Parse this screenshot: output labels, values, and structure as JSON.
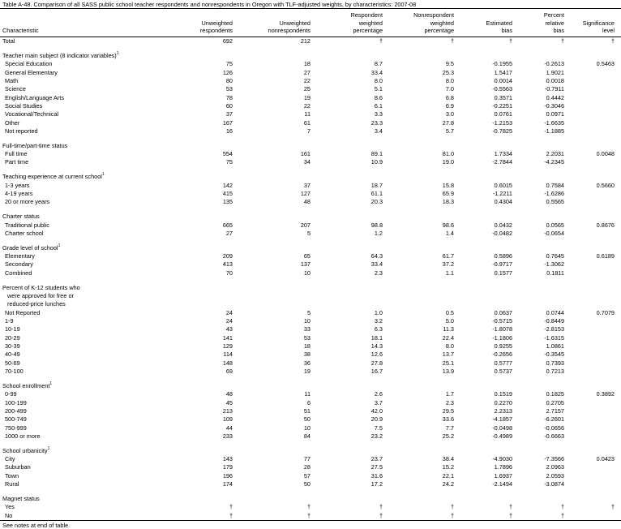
{
  "title": "Table A-48. Comparison of all SASS public school teacher respondents and nonrespondents in Oregon with TLF-adjusted weights, by characteristics: 2007-08",
  "headers": [
    "Characteristic",
    "Unweighted\nrespondents",
    "Unweighted\nnonrespondents",
    "Respondent\nweighted\npercentage",
    "Nonrespondent\nweighted\npercentage",
    "Estimated\nbias",
    "Percent\nrelative\nbias",
    "Significance\nlevel"
  ],
  "rows": [
    {
      "t": "data",
      "ind": 0,
      "cells": [
        "Total",
        "692",
        "212",
        "†",
        "†",
        "†",
        "†",
        "†"
      ]
    },
    {
      "t": "sp"
    },
    {
      "t": "head",
      "label": "Teacher main subject (8 indicator variables)",
      "sup": "1"
    },
    {
      "t": "data",
      "ind": 1,
      "cells": [
        "Special Education",
        "75",
        "18",
        "8.7",
        "9.5",
        "-0.1955",
        "-0.2613",
        "0.5463"
      ]
    },
    {
      "t": "data",
      "ind": 1,
      "cells": [
        "General Elementary",
        "126",
        "27",
        "33.4",
        "25.3",
        "1.5417",
        "1.9021",
        ""
      ]
    },
    {
      "t": "data",
      "ind": 1,
      "cells": [
        "Math",
        "80",
        "22",
        "8.0",
        "8.0",
        "0.0014",
        "0.0018",
        ""
      ]
    },
    {
      "t": "data",
      "ind": 1,
      "cells": [
        "Science",
        "53",
        "25",
        "5.1",
        "7.0",
        "-0.5563",
        "-0.7911",
        ""
      ]
    },
    {
      "t": "data",
      "ind": 1,
      "cells": [
        "English/Language Arts",
        "78",
        "19",
        "8.6",
        "6.8",
        "0.3571",
        "0.4442",
        ""
      ]
    },
    {
      "t": "data",
      "ind": 1,
      "cells": [
        "Social Studies",
        "60",
        "22",
        "6.1",
        "6.9",
        "-0.2251",
        "-0.3046",
        ""
      ]
    },
    {
      "t": "data",
      "ind": 1,
      "cells": [
        "Vocational/Technical",
        "37",
        "11",
        "3.3",
        "3.0",
        "0.0761",
        "0.0971",
        ""
      ]
    },
    {
      "t": "data",
      "ind": 1,
      "cells": [
        "Other",
        "167",
        "61",
        "23.3",
        "27.8",
        "-1.2153",
        "-1.6635",
        ""
      ]
    },
    {
      "t": "data",
      "ind": 1,
      "cells": [
        "Not reported",
        "16",
        "7",
        "3.4",
        "5.7",
        "-0.7825",
        "-1.1885",
        ""
      ]
    },
    {
      "t": "sp"
    },
    {
      "t": "head",
      "label": "Full-time/part-time status",
      "sup": ""
    },
    {
      "t": "data",
      "ind": 1,
      "cells": [
        "Full time",
        "554",
        "161",
        "89.1",
        "81.0",
        "1.7334",
        "2.2031",
        "0.0048"
      ]
    },
    {
      "t": "data",
      "ind": 1,
      "cells": [
        "Part time",
        "75",
        "34",
        "10.9",
        "19.0",
        "-2.7844",
        "-4.2345",
        ""
      ]
    },
    {
      "t": "sp"
    },
    {
      "t": "head",
      "label": "Teaching experience at current school",
      "sup": "1"
    },
    {
      "t": "data",
      "ind": 1,
      "cells": [
        "1-3 years",
        "142",
        "37",
        "18.7",
        "15.8",
        "0.6015",
        "0.7584",
        "0.5660"
      ]
    },
    {
      "t": "data",
      "ind": 1,
      "cells": [
        "4-19 years",
        "415",
        "127",
        "61.1",
        "65.9",
        "-1.2211",
        "-1.6286",
        ""
      ]
    },
    {
      "t": "data",
      "ind": 1,
      "cells": [
        "20 or more years",
        "135",
        "48",
        "20.3",
        "18.3",
        "0.4304",
        "0.5565",
        ""
      ]
    },
    {
      "t": "sp"
    },
    {
      "t": "head",
      "label": "Charter status",
      "sup": ""
    },
    {
      "t": "data",
      "ind": 1,
      "cells": [
        "Traditional public",
        "665",
        "207",
        "98.8",
        "98.6",
        "0.0432",
        "0.0565",
        "0.8676"
      ]
    },
    {
      "t": "data",
      "ind": 1,
      "cells": [
        "Charter school",
        "27",
        "5",
        "1.2",
        "1.4",
        "-0.0482",
        "-0.0654",
        ""
      ]
    },
    {
      "t": "sp"
    },
    {
      "t": "head",
      "label": "Grade level of school",
      "sup": "1"
    },
    {
      "t": "data",
      "ind": 1,
      "cells": [
        "Elementary",
        "209",
        "65",
        "64.3",
        "61.7",
        "0.5896",
        "0.7645",
        "0.6189"
      ]
    },
    {
      "t": "data",
      "ind": 1,
      "cells": [
        "Secondary",
        "413",
        "137",
        "33.4",
        "37.2",
        "-0.9717",
        "-1.3062",
        ""
      ]
    },
    {
      "t": "data",
      "ind": 1,
      "cells": [
        "Combined",
        "70",
        "10",
        "2.3",
        "1.1",
        "0.1577",
        "0.1811",
        ""
      ]
    },
    {
      "t": "sp"
    },
    {
      "t": "head",
      "label": "Percent of K-12 students who",
      "sup": ""
    },
    {
      "t": "data",
      "ind": 2,
      "cells": [
        "were approved for free or",
        "",
        "",
        "",
        "",
        "",
        "",
        ""
      ]
    },
    {
      "t": "data",
      "ind": 2,
      "cells": [
        "reduced-price lunches",
        "",
        "",
        "",
        "",
        "",
        "",
        ""
      ]
    },
    {
      "t": "data",
      "ind": 1,
      "cells": [
        "Not Reported",
        "24",
        "5",
        "1.0",
        "0.5",
        "0.0637",
        "0.0744",
        "0.7079"
      ]
    },
    {
      "t": "data",
      "ind": 1,
      "cells": [
        "1-9",
        "24",
        "10",
        "3.2",
        "5.0",
        "-0.5715",
        "-0.8449",
        ""
      ]
    },
    {
      "t": "data",
      "ind": 1,
      "cells": [
        "10-19",
        "43",
        "33",
        "6.3",
        "11.3",
        "-1.8078",
        "-2.8153",
        ""
      ]
    },
    {
      "t": "data",
      "ind": 1,
      "cells": [
        "20-29",
        "141",
        "53",
        "18.1",
        "22.4",
        "-1.1806",
        "-1.6315",
        ""
      ]
    },
    {
      "t": "data",
      "ind": 1,
      "cells": [
        "30-39",
        "129",
        "18",
        "14.3",
        "8.0",
        "0.9255",
        "1.0861",
        ""
      ]
    },
    {
      "t": "data",
      "ind": 1,
      "cells": [
        "40-49",
        "114",
        "38",
        "12.6",
        "13.7",
        "-0.2656",
        "-0.3545",
        ""
      ]
    },
    {
      "t": "data",
      "ind": 1,
      "cells": [
        "50-69",
        "148",
        "36",
        "27.8",
        "25.1",
        "0.5777",
        "0.7393",
        ""
      ]
    },
    {
      "t": "data",
      "ind": 1,
      "cells": [
        "70-100",
        "69",
        "19",
        "16.7",
        "13.9",
        "0.5737",
        "0.7213",
        ""
      ]
    },
    {
      "t": "sp"
    },
    {
      "t": "head",
      "label": "School enrollment",
      "sup": "1"
    },
    {
      "t": "data",
      "ind": 1,
      "cells": [
        "0-99",
        "48",
        "11",
        "2.6",
        "1.7",
        "0.1519",
        "0.1825",
        "0.3892"
      ]
    },
    {
      "t": "data",
      "ind": 1,
      "cells": [
        "100-199",
        "45",
        "6",
        "3.7",
        "2.3",
        "0.2270",
        "0.2705",
        ""
      ]
    },
    {
      "t": "data",
      "ind": 1,
      "cells": [
        "200-499",
        "213",
        "51",
        "42.0",
        "29.5",
        "2.2313",
        "2.7157",
        ""
      ]
    },
    {
      "t": "data",
      "ind": 1,
      "cells": [
        "500-749",
        "109",
        "50",
        "20.9",
        "33.6",
        "-4.1857",
        "-6.2601",
        ""
      ]
    },
    {
      "t": "data",
      "ind": 1,
      "cells": [
        "750-999",
        "44",
        "10",
        "7.5",
        "7.7",
        "-0.0498",
        "-0.0656",
        ""
      ]
    },
    {
      "t": "data",
      "ind": 1,
      "cells": [
        "1000 or more",
        "233",
        "84",
        "23.2",
        "25.2",
        "-0.4989",
        "-0.6663",
        ""
      ]
    },
    {
      "t": "sp"
    },
    {
      "t": "head",
      "label": "School urbanicity",
      "sup": "1"
    },
    {
      "t": "data",
      "ind": 1,
      "cells": [
        "City",
        "143",
        "77",
        "23.7",
        "38.4",
        "-4.9030",
        "-7.3566",
        "0.0423"
      ]
    },
    {
      "t": "data",
      "ind": 1,
      "cells": [
        "Suburban",
        "179",
        "28",
        "27.5",
        "15.2",
        "1.7896",
        "2.0963",
        ""
      ]
    },
    {
      "t": "data",
      "ind": 1,
      "cells": [
        "Town",
        "196",
        "57",
        "31.6",
        "22.1",
        "1.6937",
        "2.0593",
        ""
      ]
    },
    {
      "t": "data",
      "ind": 1,
      "cells": [
        "Rural",
        "174",
        "50",
        "17.2",
        "24.2",
        "-2.1494",
        "-3.0874",
        ""
      ]
    },
    {
      "t": "sp"
    },
    {
      "t": "head",
      "label": "Magnet status",
      "sup": ""
    },
    {
      "t": "data",
      "ind": 1,
      "cells": [
        "Yes",
        "†",
        "†",
        "†",
        "†",
        "†",
        "†",
        "†"
      ]
    },
    {
      "t": "data",
      "ind": 1,
      "cells": [
        "No",
        "†",
        "†",
        "†",
        "†",
        "†",
        "†",
        ""
      ]
    }
  ],
  "footnote": "See notes at end of table."
}
